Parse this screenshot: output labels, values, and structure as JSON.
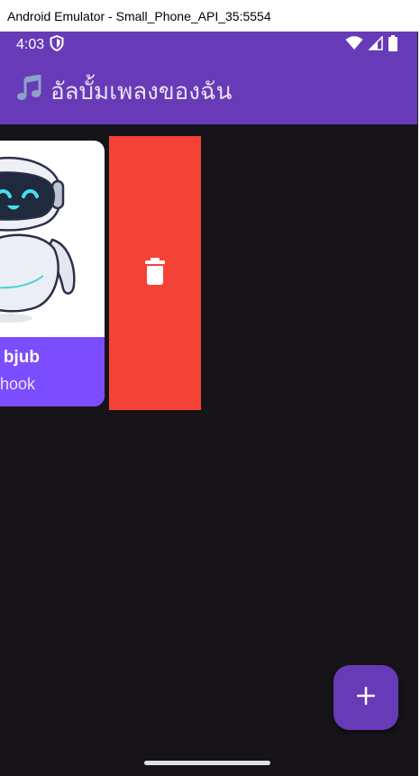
{
  "window": {
    "title": "Android Emulator - Small_Phone_API_35:5554"
  },
  "status_bar": {
    "time": "4:03",
    "icons": [
      "shield-icon",
      "wifi-icon",
      "signal-icon",
      "battery-icon"
    ]
  },
  "app_bar": {
    "icon": "music-note-icon",
    "title": "อัลบั้มเพลงของฉัน"
  },
  "album_card": {
    "title": "bjub",
    "subtitle": "hook",
    "image": "robot-illustration"
  },
  "swipe_action": {
    "icon": "trash-icon",
    "color": "#f44336"
  },
  "fab": {
    "icon": "plus-icon"
  },
  "colors": {
    "primary": "#673ab7",
    "card_footer": "#7c4dff",
    "background": "#161419",
    "delete": "#f44336"
  }
}
